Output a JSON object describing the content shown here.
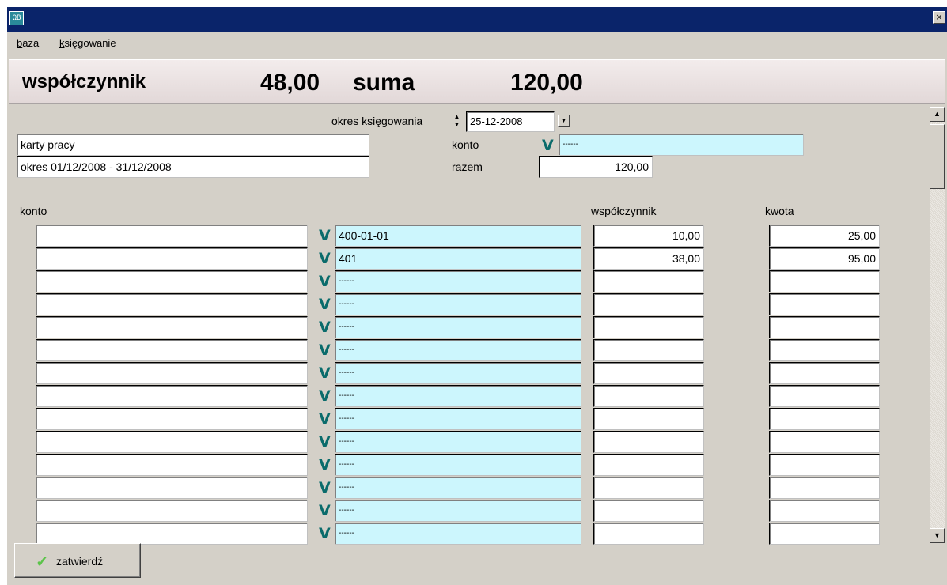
{
  "window": {
    "app_icon_text": "ΩB",
    "close_symbol": "×"
  },
  "menu": {
    "baza": {
      "accel": "b",
      "rest": "aza"
    },
    "ksiegowanie": {
      "accel": "k",
      "rest": "sięgowanie"
    }
  },
  "summary": {
    "label": "współczynnik",
    "value": "48,00",
    "suma_label": "suma",
    "suma_value": "120,00"
  },
  "form": {
    "okres_label": "okres księgowania",
    "date": "25-12-2008",
    "title": "karty pracy",
    "period": "okres 01/12/2008 - 31/12/2008",
    "konto_label": "konto",
    "konto_value": "------",
    "razem_label": "razem",
    "razem_value": "120,00"
  },
  "table": {
    "headers": {
      "konto": "konto",
      "wspolczynnik": "współczynnik",
      "kwota": "kwota"
    },
    "rows": [
      {
        "account": "400-01-01",
        "coef": "10,00",
        "amount": "25,00"
      },
      {
        "account": "401",
        "coef": "38,00",
        "amount": "95,00"
      },
      {
        "account": "------",
        "coef": "",
        "amount": ""
      },
      {
        "account": "------",
        "coef": "",
        "amount": ""
      },
      {
        "account": "------",
        "coef": "",
        "amount": ""
      },
      {
        "account": "------",
        "coef": "",
        "amount": ""
      },
      {
        "account": "------",
        "coef": "",
        "amount": ""
      },
      {
        "account": "------",
        "coef": "",
        "amount": ""
      },
      {
        "account": "------",
        "coef": "",
        "amount": ""
      },
      {
        "account": "------",
        "coef": "",
        "amount": ""
      },
      {
        "account": "------",
        "coef": "",
        "amount": ""
      },
      {
        "account": "------",
        "coef": "",
        "amount": ""
      },
      {
        "account": "------",
        "coef": "",
        "amount": ""
      },
      {
        "account": "------",
        "coef": "",
        "amount": ""
      }
    ]
  },
  "button": {
    "label": "zatwierdź"
  },
  "colors": {
    "titlebar": "#0a246a",
    "lookup_field": "#ccf6fd",
    "check_icon": "#0a6b6b",
    "ok_check": "#5cc44a"
  }
}
